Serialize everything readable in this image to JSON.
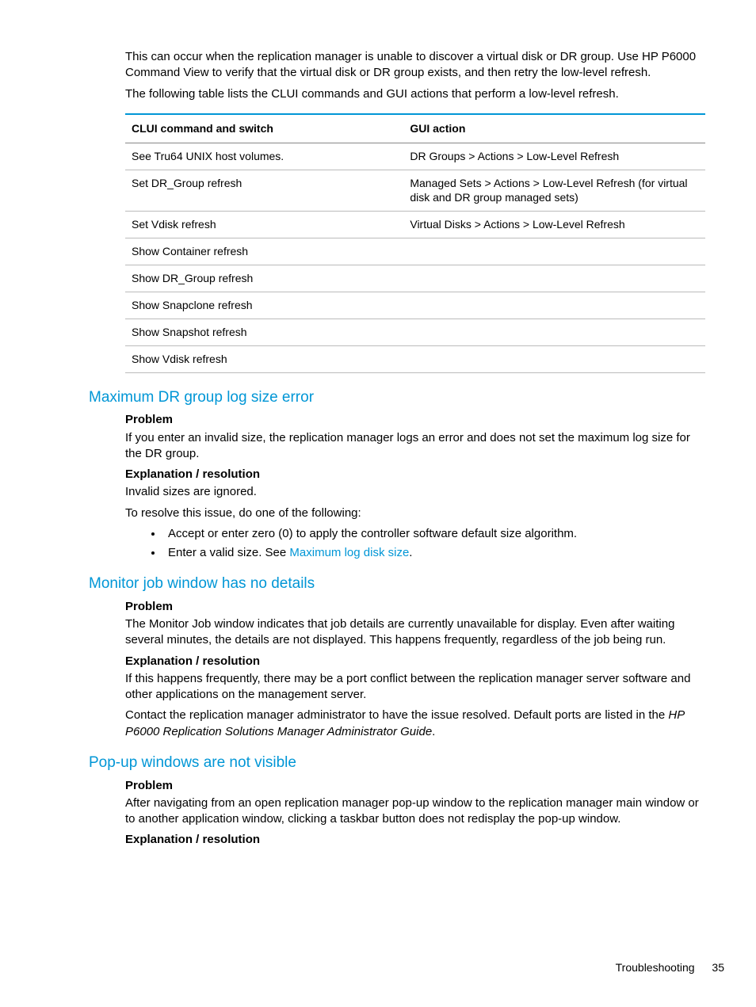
{
  "intro": {
    "p1": "This can occur when the replication manager is unable to discover a virtual disk or DR group. Use HP P6000 Command View to verify that the virtual disk or DR group exists, and then retry the low-level refresh.",
    "p2": "The following table lists the CLUI commands and GUI actions that perform a low-level refresh."
  },
  "table": {
    "headers": {
      "c1": "CLUI command and switch",
      "c2": "GUI action"
    },
    "rows": [
      {
        "c1": "See Tru64 UNIX host volumes.",
        "c2": "DR Groups > Actions > Low-Level Refresh"
      },
      {
        "c1": "Set DR_Group refresh",
        "c2": "Managed Sets > Actions > Low-Level Refresh (for virtual disk and DR group managed sets)"
      },
      {
        "c1": "Set Vdisk refresh",
        "c2": "Virtual Disks > Actions > Low-Level Refresh"
      },
      {
        "c1": "Show Container refresh",
        "c2": ""
      },
      {
        "c1": "Show DR_Group refresh",
        "c2": ""
      },
      {
        "c1": "Show Snapclone refresh",
        "c2": ""
      },
      {
        "c1": "Show Snapshot refresh",
        "c2": ""
      },
      {
        "c1": "Show Vdisk refresh",
        "c2": ""
      }
    ]
  },
  "s1": {
    "title": "Maximum DR group log size error",
    "problem_h": "Problem",
    "problem": "If you enter an invalid size, the replication manager logs an error and does not set the maximum log size for the DR group.",
    "exp_h": "Explanation / resolution",
    "exp1": "Invalid sizes are ignored.",
    "exp2": "To resolve this issue, do one of the following:",
    "b1": "Accept or enter zero (0) to apply the controller software default size algorithm.",
    "b2a": "Enter a valid size. See ",
    "b2link": "Maximum log disk size",
    "b2b": "."
  },
  "s2": {
    "title": "Monitor job window has no details",
    "problem_h": "Problem",
    "problem": "The Monitor Job window indicates that job details are currently unavailable for display. Even after waiting several minutes, the details are not displayed. This happens frequently, regardless of the job being run.",
    "exp_h": "Explanation / resolution",
    "exp1": "If this happens frequently, there may be a port conflict between the replication manager server software and other applications on the management server.",
    "exp2a": "Contact the replication manager administrator to have the issue resolved. Default ports are listed in the ",
    "exp2i": "HP P6000 Replication Solutions Manager Administrator Guide",
    "exp2b": "."
  },
  "s3": {
    "title": "Pop-up windows are not visible",
    "problem_h": "Problem",
    "problem": "After navigating from an open replication manager pop-up window to the replication manager main window or to another application window, clicking a taskbar button does not redisplay the pop-up window.",
    "exp_h": "Explanation / resolution"
  },
  "footer": {
    "label": "Troubleshooting",
    "page": "35"
  }
}
